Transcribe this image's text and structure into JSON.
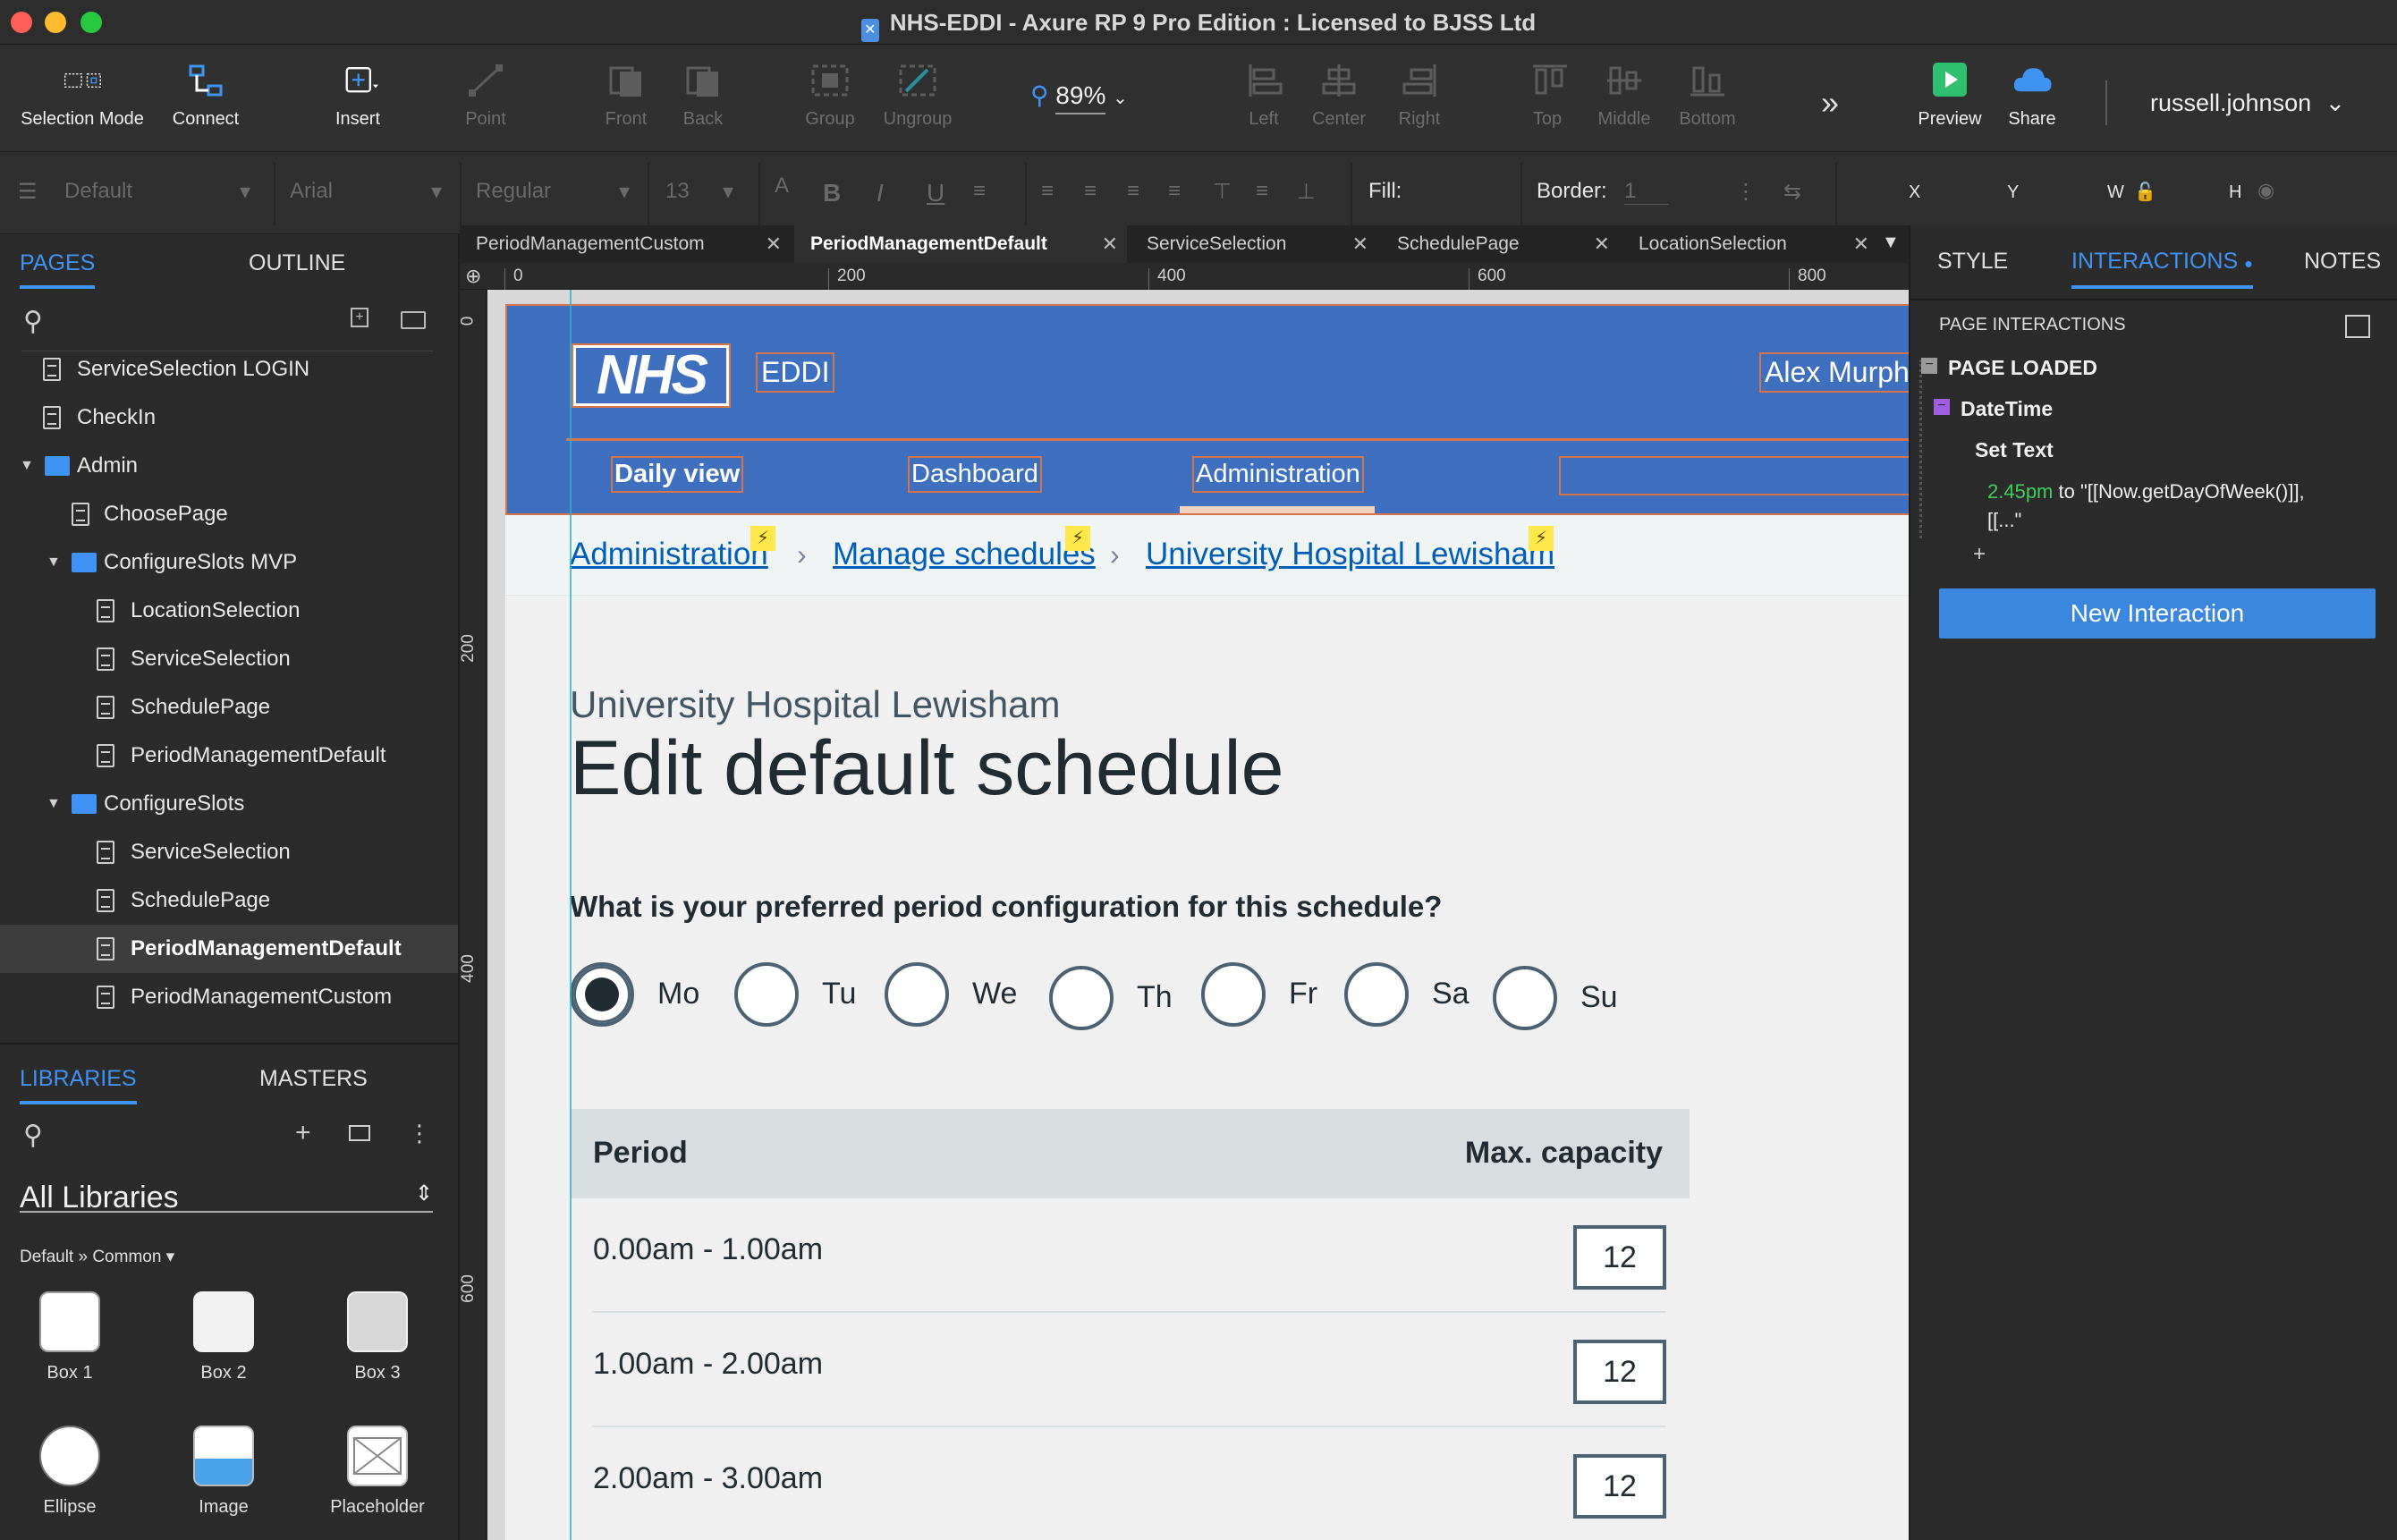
{
  "window": {
    "title": "NHS-EDDI - Axure RP 9 Pro Edition : Licensed to BJSS Ltd"
  },
  "toolbar": {
    "selection_mode": "Selection Mode",
    "connect": "Connect",
    "insert": "Insert",
    "point": "Point",
    "front": "Front",
    "back": "Back",
    "group": "Group",
    "ungroup": "Ungroup",
    "zoom": "89%",
    "left": "Left",
    "center": "Center",
    "right": "Right",
    "top": "Top",
    "middle": "Middle",
    "bottom": "Bottom",
    "more": "»",
    "preview": "Preview",
    "share": "Share",
    "user": "russell.johnson"
  },
  "formatbar": {
    "style": "Default",
    "font": "Arial",
    "weight": "Regular",
    "size": "13",
    "fill_label": "Fill:",
    "border_label": "Border:",
    "border_value": "1",
    "x": "X",
    "y": "Y",
    "w": "W",
    "h": "H"
  },
  "left_panel": {
    "tab_pages": "PAGES",
    "tab_outline": "OUTLINE",
    "pages": [
      {
        "label": "ServiceSelection LOGIN"
      },
      {
        "label": "CheckIn"
      },
      {
        "label": "Admin"
      },
      {
        "label": "ChoosePage"
      },
      {
        "label": "ConfigureSlots MVP"
      },
      {
        "label": "LocationSelection"
      },
      {
        "label": "ServiceSelection"
      },
      {
        "label": "SchedulePage"
      },
      {
        "label": "PeriodManagementDefault"
      },
      {
        "label": "ConfigureSlots"
      },
      {
        "label": "ServiceSelection"
      },
      {
        "label": "SchedulePage"
      },
      {
        "label": "PeriodManagementDefault"
      },
      {
        "label": "PeriodManagementCustom"
      }
    ],
    "tab_libraries": "LIBRARIES",
    "tab_masters": "MASTERS",
    "library_select": "All Libraries",
    "library_path": "Default » Common ▾",
    "widgets": [
      "Box 1",
      "Box 2",
      "Box 3",
      "Ellipse",
      "Image",
      "Placeholder"
    ]
  },
  "doc_tabs": [
    {
      "label": "PeriodManagementCustom"
    },
    {
      "label": "PeriodManagementDefault"
    },
    {
      "label": "ServiceSelection"
    },
    {
      "label": "SchedulePage"
    },
    {
      "label": "LocationSelection"
    }
  ],
  "rulers": {
    "top": [
      "0",
      "200",
      "400",
      "600",
      "800"
    ],
    "left": [
      "0",
      "200",
      "400",
      "600"
    ]
  },
  "prototype": {
    "logo": "NHS",
    "app_name": "EDDI",
    "user_name": "Alex Murph",
    "nav": [
      "Daily view",
      "Dashboard",
      "Administration"
    ],
    "breadcrumbs": [
      "Administration",
      "Manage schedules",
      "University Hospital Lewisham"
    ],
    "caption": "University Hospital Lewisham",
    "heading": "Edit default schedule",
    "question": "What is your preferred period configuration for this schedule?",
    "days": [
      "Mo",
      "Tu",
      "We",
      "Th",
      "Fr",
      "Sa",
      "Su"
    ],
    "selected_day": "Mo",
    "table": {
      "col_period": "Period",
      "col_capacity": "Max. capacity",
      "rows": [
        {
          "period": "0.00am - 1.00am",
          "capacity": "12"
        },
        {
          "period": "1.00am - 2.00am",
          "capacity": "12"
        },
        {
          "period": "2.00am - 3.00am",
          "capacity": "12"
        }
      ]
    }
  },
  "right_panel": {
    "tab_style": "STYLE",
    "tab_interactions": "INTERACTIONS",
    "tab_notes": "NOTES",
    "section": "PAGE INTERACTIONS",
    "event": "PAGE LOADED",
    "case": "DateTime",
    "action": "Set Text",
    "detail_time": "2.45pm",
    "detail_text": " to \"[[Now.getDayOfWeek()]],",
    "detail_more": "[[...\"",
    "add": "+",
    "new_interaction": "New Interaction"
  },
  "colors": {
    "nhs_blue": "#3f70bf",
    "link_blue": "#005eb8",
    "accent": "#3f93f3",
    "preview_green": "#2fbf71"
  }
}
